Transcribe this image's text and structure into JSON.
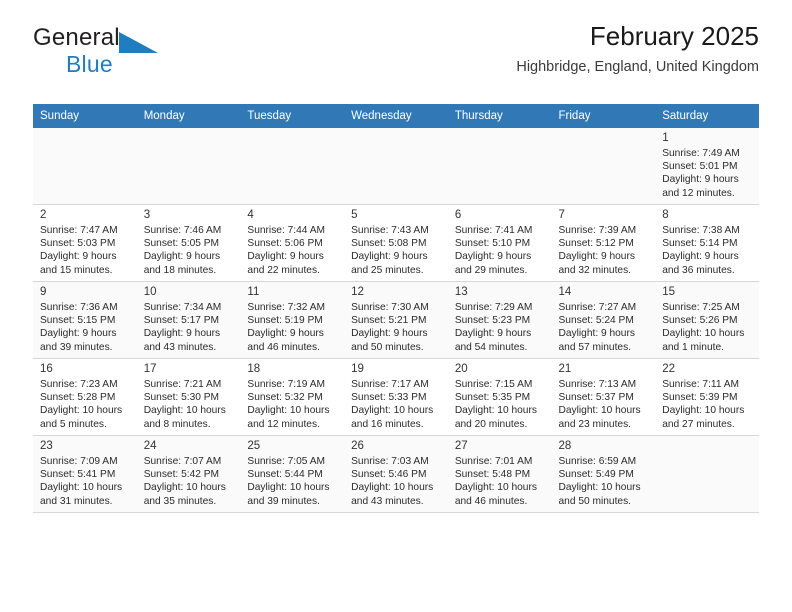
{
  "brand": {
    "name_top": "General",
    "name_bottom": "Blue",
    "logo_icon": "triangle-flag-icon",
    "accent_color": "#1f7dc0"
  },
  "header": {
    "title": "February 2025",
    "subtitle": "Highbridge, England, United Kingdom"
  },
  "calendar": {
    "header_bg": "#3079b6",
    "weekday_headers": [
      "Sunday",
      "Monday",
      "Tuesday",
      "Wednesday",
      "Thursday",
      "Friday",
      "Saturday"
    ],
    "weeks": [
      [
        {
          "day": "",
          "sunrise": "",
          "sunset": "",
          "daylight_1": "",
          "daylight_2": ""
        },
        {
          "day": "",
          "sunrise": "",
          "sunset": "",
          "daylight_1": "",
          "daylight_2": ""
        },
        {
          "day": "",
          "sunrise": "",
          "sunset": "",
          "daylight_1": "",
          "daylight_2": ""
        },
        {
          "day": "",
          "sunrise": "",
          "sunset": "",
          "daylight_1": "",
          "daylight_2": ""
        },
        {
          "day": "",
          "sunrise": "",
          "sunset": "",
          "daylight_1": "",
          "daylight_2": ""
        },
        {
          "day": "",
          "sunrise": "",
          "sunset": "",
          "daylight_1": "",
          "daylight_2": ""
        },
        {
          "day": "1",
          "sunrise": "Sunrise: 7:49 AM",
          "sunset": "Sunset: 5:01 PM",
          "daylight_1": "Daylight: 9 hours",
          "daylight_2": "and 12 minutes."
        }
      ],
      [
        {
          "day": "2",
          "sunrise": "Sunrise: 7:47 AM",
          "sunset": "Sunset: 5:03 PM",
          "daylight_1": "Daylight: 9 hours",
          "daylight_2": "and 15 minutes."
        },
        {
          "day": "3",
          "sunrise": "Sunrise: 7:46 AM",
          "sunset": "Sunset: 5:05 PM",
          "daylight_1": "Daylight: 9 hours",
          "daylight_2": "and 18 minutes."
        },
        {
          "day": "4",
          "sunrise": "Sunrise: 7:44 AM",
          "sunset": "Sunset: 5:06 PM",
          "daylight_1": "Daylight: 9 hours",
          "daylight_2": "and 22 minutes."
        },
        {
          "day": "5",
          "sunrise": "Sunrise: 7:43 AM",
          "sunset": "Sunset: 5:08 PM",
          "daylight_1": "Daylight: 9 hours",
          "daylight_2": "and 25 minutes."
        },
        {
          "day": "6",
          "sunrise": "Sunrise: 7:41 AM",
          "sunset": "Sunset: 5:10 PM",
          "daylight_1": "Daylight: 9 hours",
          "daylight_2": "and 29 minutes."
        },
        {
          "day": "7",
          "sunrise": "Sunrise: 7:39 AM",
          "sunset": "Sunset: 5:12 PM",
          "daylight_1": "Daylight: 9 hours",
          "daylight_2": "and 32 minutes."
        },
        {
          "day": "8",
          "sunrise": "Sunrise: 7:38 AM",
          "sunset": "Sunset: 5:14 PM",
          "daylight_1": "Daylight: 9 hours",
          "daylight_2": "and 36 minutes."
        }
      ],
      [
        {
          "day": "9",
          "sunrise": "Sunrise: 7:36 AM",
          "sunset": "Sunset: 5:15 PM",
          "daylight_1": "Daylight: 9 hours",
          "daylight_2": "and 39 minutes."
        },
        {
          "day": "10",
          "sunrise": "Sunrise: 7:34 AM",
          "sunset": "Sunset: 5:17 PM",
          "daylight_1": "Daylight: 9 hours",
          "daylight_2": "and 43 minutes."
        },
        {
          "day": "11",
          "sunrise": "Sunrise: 7:32 AM",
          "sunset": "Sunset: 5:19 PM",
          "daylight_1": "Daylight: 9 hours",
          "daylight_2": "and 46 minutes."
        },
        {
          "day": "12",
          "sunrise": "Sunrise: 7:30 AM",
          "sunset": "Sunset: 5:21 PM",
          "daylight_1": "Daylight: 9 hours",
          "daylight_2": "and 50 minutes."
        },
        {
          "day": "13",
          "sunrise": "Sunrise: 7:29 AM",
          "sunset": "Sunset: 5:23 PM",
          "daylight_1": "Daylight: 9 hours",
          "daylight_2": "and 54 minutes."
        },
        {
          "day": "14",
          "sunrise": "Sunrise: 7:27 AM",
          "sunset": "Sunset: 5:24 PM",
          "daylight_1": "Daylight: 9 hours",
          "daylight_2": "and 57 minutes."
        },
        {
          "day": "15",
          "sunrise": "Sunrise: 7:25 AM",
          "sunset": "Sunset: 5:26 PM",
          "daylight_1": "Daylight: 10 hours",
          "daylight_2": "and 1 minute."
        }
      ],
      [
        {
          "day": "16",
          "sunrise": "Sunrise: 7:23 AM",
          "sunset": "Sunset: 5:28 PM",
          "daylight_1": "Daylight: 10 hours",
          "daylight_2": "and 5 minutes."
        },
        {
          "day": "17",
          "sunrise": "Sunrise: 7:21 AM",
          "sunset": "Sunset: 5:30 PM",
          "daylight_1": "Daylight: 10 hours",
          "daylight_2": "and 8 minutes."
        },
        {
          "day": "18",
          "sunrise": "Sunrise: 7:19 AM",
          "sunset": "Sunset: 5:32 PM",
          "daylight_1": "Daylight: 10 hours",
          "daylight_2": "and 12 minutes."
        },
        {
          "day": "19",
          "sunrise": "Sunrise: 7:17 AM",
          "sunset": "Sunset: 5:33 PM",
          "daylight_1": "Daylight: 10 hours",
          "daylight_2": "and 16 minutes."
        },
        {
          "day": "20",
          "sunrise": "Sunrise: 7:15 AM",
          "sunset": "Sunset: 5:35 PM",
          "daylight_1": "Daylight: 10 hours",
          "daylight_2": "and 20 minutes."
        },
        {
          "day": "21",
          "sunrise": "Sunrise: 7:13 AM",
          "sunset": "Sunset: 5:37 PM",
          "daylight_1": "Daylight: 10 hours",
          "daylight_2": "and 23 minutes."
        },
        {
          "day": "22",
          "sunrise": "Sunrise: 7:11 AM",
          "sunset": "Sunset: 5:39 PM",
          "daylight_1": "Daylight: 10 hours",
          "daylight_2": "and 27 minutes."
        }
      ],
      [
        {
          "day": "23",
          "sunrise": "Sunrise: 7:09 AM",
          "sunset": "Sunset: 5:41 PM",
          "daylight_1": "Daylight: 10 hours",
          "daylight_2": "and 31 minutes."
        },
        {
          "day": "24",
          "sunrise": "Sunrise: 7:07 AM",
          "sunset": "Sunset: 5:42 PM",
          "daylight_1": "Daylight: 10 hours",
          "daylight_2": "and 35 minutes."
        },
        {
          "day": "25",
          "sunrise": "Sunrise: 7:05 AM",
          "sunset": "Sunset: 5:44 PM",
          "daylight_1": "Daylight: 10 hours",
          "daylight_2": "and 39 minutes."
        },
        {
          "day": "26",
          "sunrise": "Sunrise: 7:03 AM",
          "sunset": "Sunset: 5:46 PM",
          "daylight_1": "Daylight: 10 hours",
          "daylight_2": "and 43 minutes."
        },
        {
          "day": "27",
          "sunrise": "Sunrise: 7:01 AM",
          "sunset": "Sunset: 5:48 PM",
          "daylight_1": "Daylight: 10 hours",
          "daylight_2": "and 46 minutes."
        },
        {
          "day": "28",
          "sunrise": "Sunrise: 6:59 AM",
          "sunset": "Sunset: 5:49 PM",
          "daylight_1": "Daylight: 10 hours",
          "daylight_2": "and 50 minutes."
        },
        {
          "day": "",
          "sunrise": "",
          "sunset": "",
          "daylight_1": "",
          "daylight_2": ""
        }
      ]
    ]
  }
}
